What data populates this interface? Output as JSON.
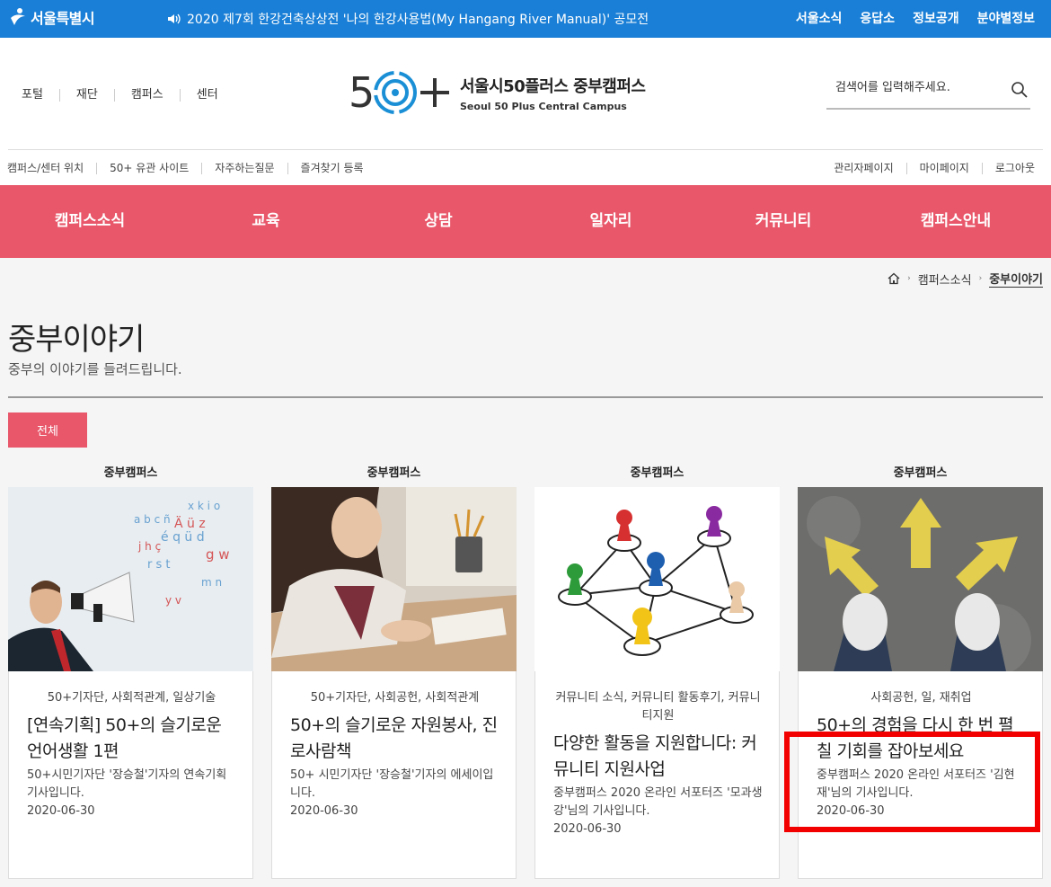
{
  "topbar": {
    "gov_logo": "서울특별시",
    "notice": "2020 제7회 한강건축상상전 '나의 한강사용법(My Hangang River Manual)' 공모전",
    "menu": [
      "서울소식",
      "응답소",
      "정보공개",
      "분야별정보"
    ],
    "colors": {
      "background": "#1a7fd6"
    }
  },
  "header": {
    "util_left": [
      "포털",
      "재단",
      "캠퍼스",
      "센터"
    ],
    "logo": {
      "mark": "50+",
      "name_ko": "서울시50플러스 중부캠퍼스",
      "name_en": "Seoul 50 Plus Central Campus"
    },
    "search": {
      "placeholder": "검색어를 입력해주세요.",
      "icon": "search-icon"
    },
    "util_links": [
      "캠퍼스/센터 위치",
      "50+ 유관 사이트",
      "자주하는질문",
      "즐겨찾기 등록"
    ],
    "account_links": [
      "관리자페이지",
      "마이페이지",
      "로그아웃"
    ]
  },
  "gnb": {
    "items": [
      "캠퍼스소식",
      "교육",
      "상담",
      "일자리",
      "커뮤니티",
      "캠퍼스안내"
    ],
    "color": "#e8576a"
  },
  "breadcrumb": {
    "items": [
      "캠퍼스소식",
      "중부이야기"
    ],
    "home_icon": "home-icon"
  },
  "page": {
    "title": "중부이야기",
    "subtitle": "중부의 이야기를 들려드립니다.",
    "filter": "전체"
  },
  "cards": [
    {
      "category": "중부캠퍼스",
      "tags": "50+기자단, 사회적관계, 일상기술",
      "title": "[연속기획] 50+의 슬기로운 언어생활 1편",
      "desc": "50+시민기자단 '장승철'기자의 연속기획 기사입니다.",
      "date": "2020-06-30"
    },
    {
      "category": "중부캠퍼스",
      "tags": "50+기자단, 사회공헌, 사회적관계",
      "title": "50+의 슬기로운 자원봉사, 진로사람책",
      "desc": "50+ 시민기자단 '장승철'기자의 에세이입니다.",
      "date": "2020-06-30"
    },
    {
      "category": "중부캠퍼스",
      "tags": "커뮤니티 소식, 커뮤니티 활동후기, 커뮤니티지원",
      "title": "다양한 활동을 지원합니다: 커뮤니티 지원사업",
      "desc": "중부캠퍼스 2020 온라인 서포터즈 '모과생강'님의 기사입니다.",
      "date": "2020-06-30"
    },
    {
      "category": "중부캠퍼스",
      "tags": "사회공헌, 일, 재취업",
      "title": "50+의 경험을 다시 한 번 펼칠 기회를 잡아보세요",
      "desc": "중부캠퍼스 2020 온라인 서포터즈 '김현재'님의 기사입니다.",
      "date": "2020-06-30"
    }
  ]
}
